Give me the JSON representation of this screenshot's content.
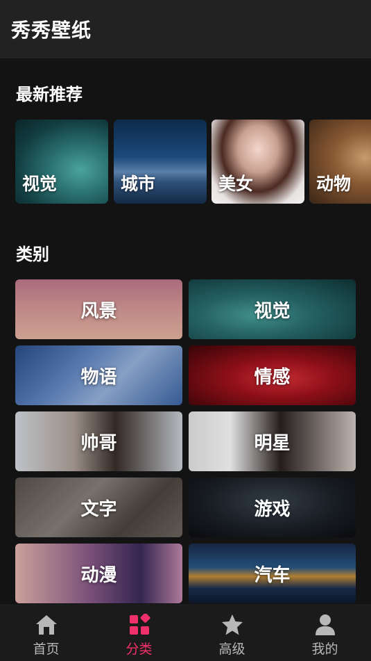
{
  "app": {
    "title": "秀秀壁纸"
  },
  "sections": {
    "latest": "最新推荐",
    "category": "类别"
  },
  "recommend": [
    {
      "label": "视觉",
      "icon": "visual-wallpaper"
    },
    {
      "label": "城市",
      "icon": "city-wallpaper"
    },
    {
      "label": "美女",
      "icon": "beauty-wallpaper"
    },
    {
      "label": "动物",
      "icon": "animal-wallpaper"
    }
  ],
  "categories": [
    {
      "label": "风景"
    },
    {
      "label": "视觉"
    },
    {
      "label": "物语"
    },
    {
      "label": "情感"
    },
    {
      "label": "帅哥"
    },
    {
      "label": "明星"
    },
    {
      "label": "文字"
    },
    {
      "label": "游戏"
    },
    {
      "label": "动漫"
    },
    {
      "label": "汽车"
    }
  ],
  "nav": [
    {
      "label": "首页",
      "icon": "home-icon",
      "active": false
    },
    {
      "label": "分类",
      "icon": "category-icon",
      "active": true
    },
    {
      "label": "高级",
      "icon": "star-icon",
      "active": false
    },
    {
      "label": "我的",
      "icon": "user-icon",
      "active": false
    }
  ],
  "colors": {
    "accent": "#f0306a",
    "topbar": "#222222",
    "background": "#131313",
    "navbar": "#1b1b1b"
  }
}
